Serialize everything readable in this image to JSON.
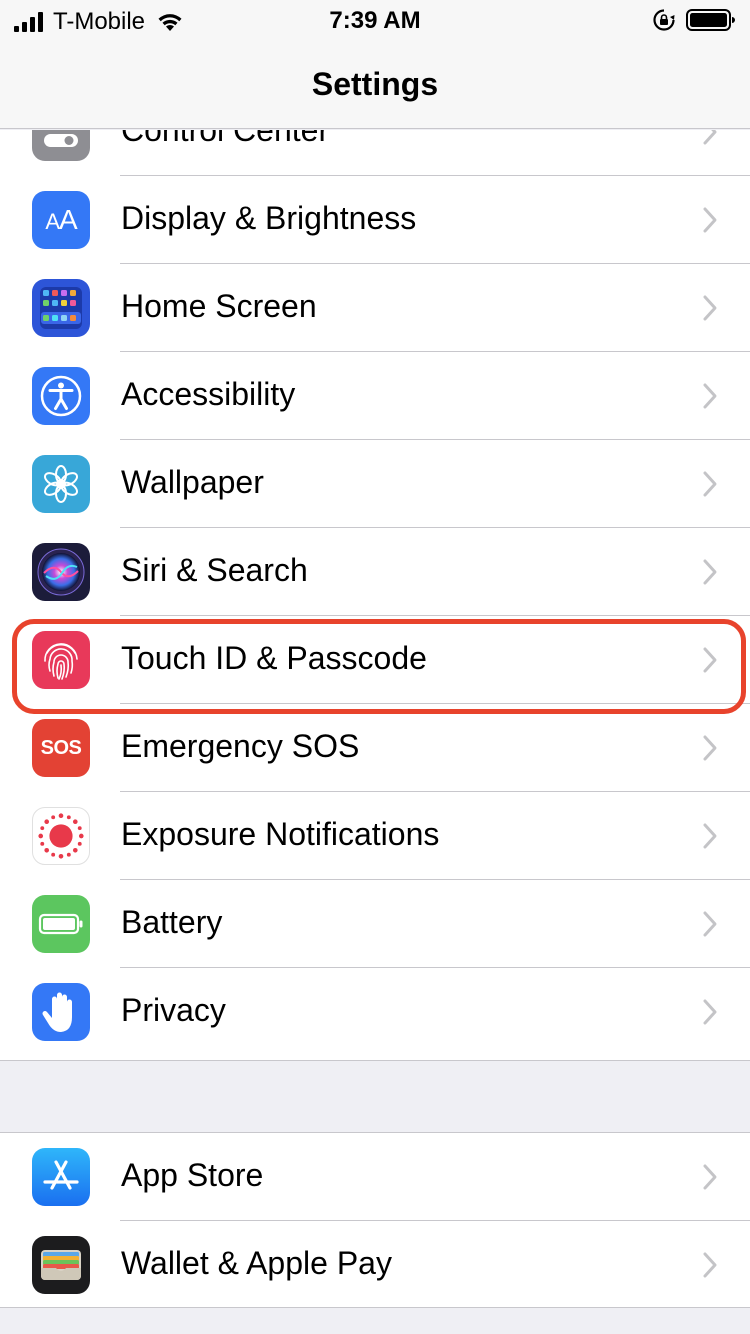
{
  "status_bar": {
    "carrier": "T-Mobile",
    "time": "7:39 AM",
    "signal_icon": "cellular-signal-icon",
    "wifi_icon": "wifi-icon",
    "rotation_lock_icon": "rotation-lock-icon",
    "battery_icon": "battery-icon"
  },
  "nav": {
    "title": "Settings"
  },
  "groups": [
    {
      "items": [
        {
          "label": "Control Center",
          "icon": "control-center-icon",
          "color": "#8e8e93"
        },
        {
          "label": "Display & Brightness",
          "icon": "display-brightness-icon",
          "color": "#3478f6"
        },
        {
          "label": "Home Screen",
          "icon": "home-screen-icon",
          "color": "#2d55d8"
        },
        {
          "label": "Accessibility",
          "icon": "accessibility-icon",
          "color": "#3478f6"
        },
        {
          "label": "Wallpaper",
          "icon": "wallpaper-icon",
          "color": "#38a7d8"
        },
        {
          "label": "Siri & Search",
          "icon": "siri-icon",
          "color": "#1c1c3a"
        },
        {
          "label": "Touch ID & Passcode",
          "icon": "fingerprint-icon",
          "color": "#e8395a",
          "highlighted": true
        },
        {
          "label": "Emergency SOS",
          "icon": "sos-icon",
          "color": "#e34234",
          "icon_text": "SOS"
        },
        {
          "label": "Exposure Notifications",
          "icon": "exposure-notifications-icon",
          "color": "#ffffff"
        },
        {
          "label": "Battery",
          "icon": "battery-settings-icon",
          "color": "#5cc65f"
        },
        {
          "label": "Privacy",
          "icon": "privacy-hand-icon",
          "color": "#3478f6"
        }
      ]
    },
    {
      "items": [
        {
          "label": "App Store",
          "icon": "app-store-icon",
          "color": "#2f8df5"
        },
        {
          "label": "Wallet & Apple Pay",
          "icon": "wallet-icon",
          "color": "#1c1c1e"
        }
      ]
    }
  ],
  "highlight_color": "#e8432c"
}
